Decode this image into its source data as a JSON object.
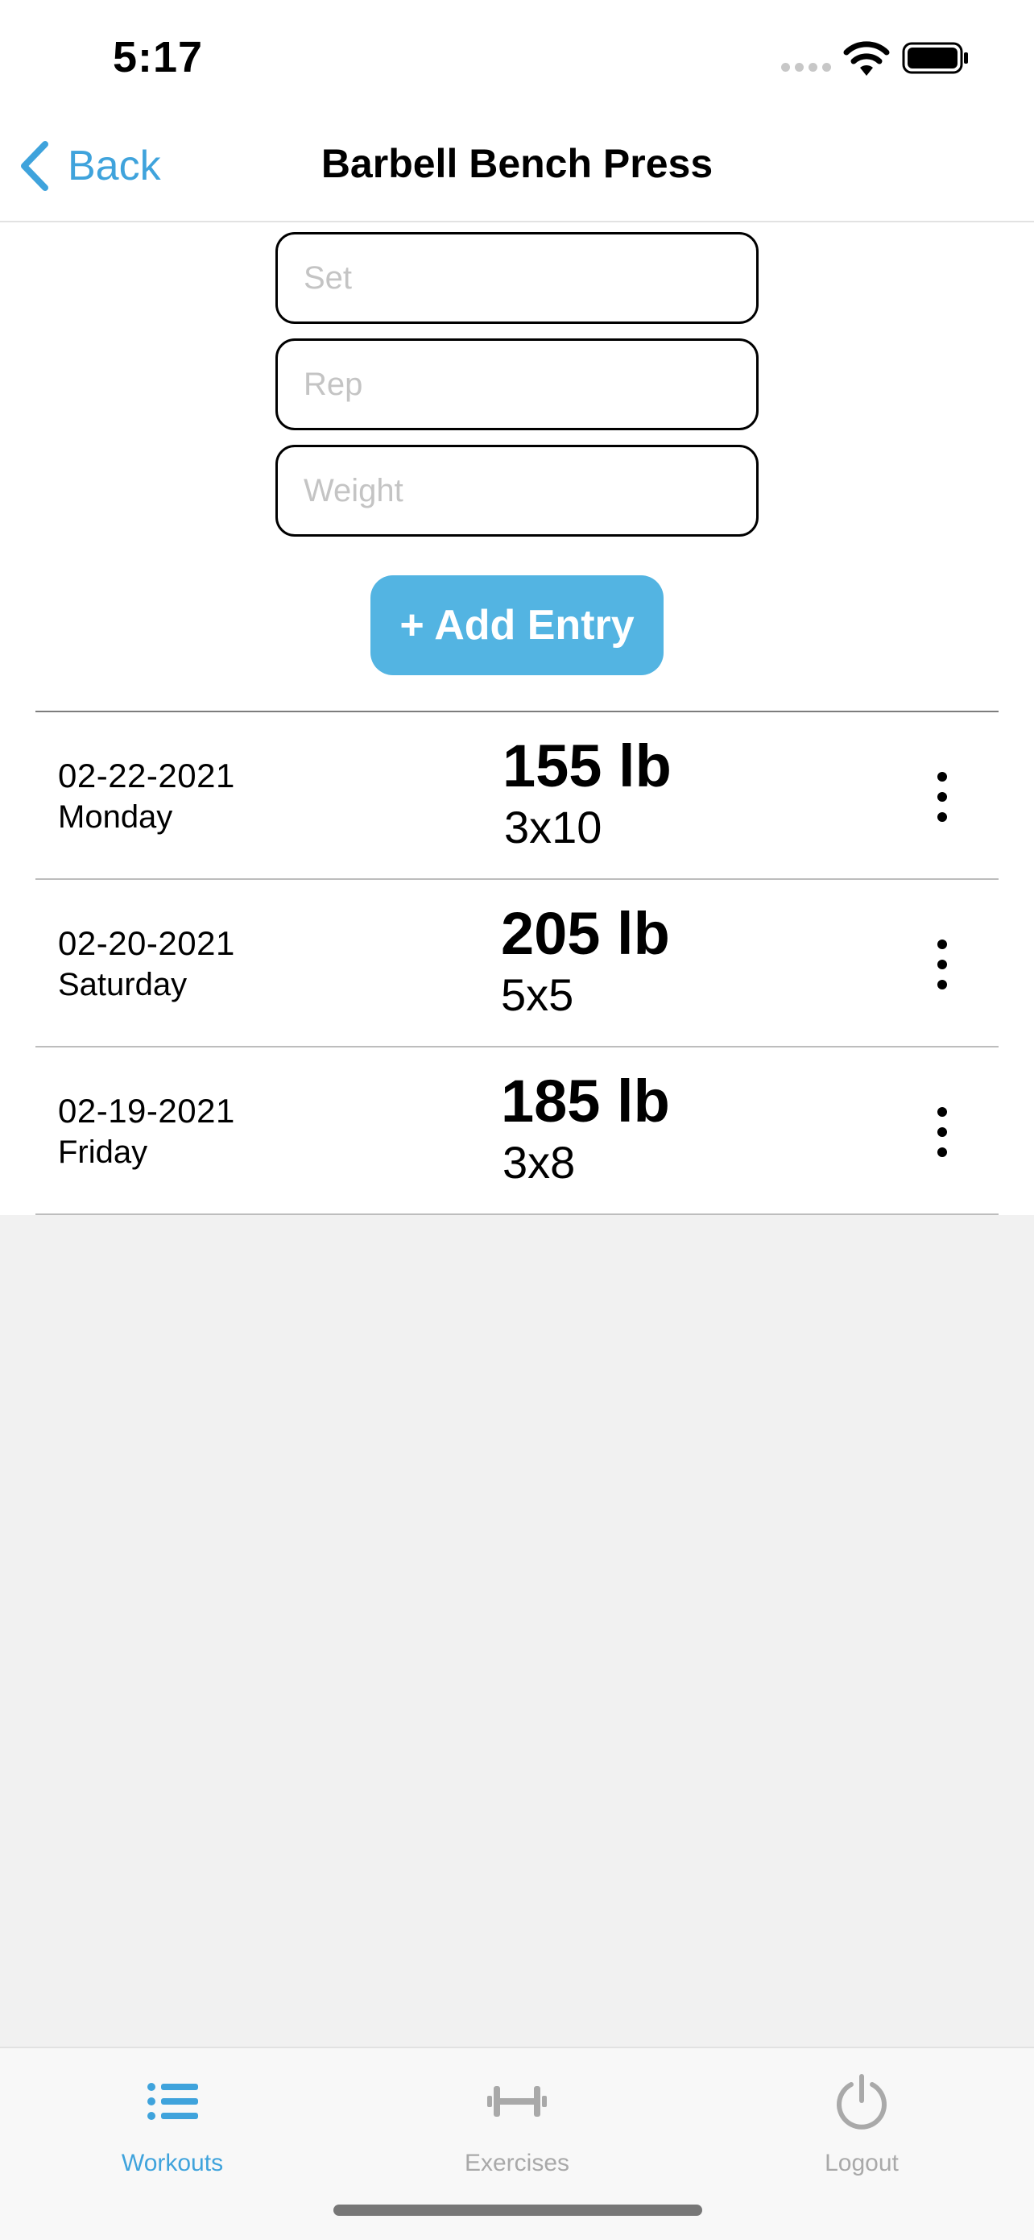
{
  "status": {
    "time": "5:17"
  },
  "nav": {
    "back_label": "Back",
    "title": "Barbell Bench Press"
  },
  "form": {
    "set_placeholder": "Set",
    "rep_placeholder": "Rep",
    "weight_placeholder": "Weight",
    "add_label": "+ Add Entry"
  },
  "entries": [
    {
      "date": "02-22-2021",
      "day": "Monday",
      "weight": "155 lb",
      "sets": "3x10"
    },
    {
      "date": "02-20-2021",
      "day": "Saturday",
      "weight": "205 lb",
      "sets": "5x5"
    },
    {
      "date": "02-19-2021",
      "day": "Friday",
      "weight": "185 lb",
      "sets": "3x8"
    }
  ],
  "tabs": [
    {
      "label": "Workouts",
      "icon": "list-icon",
      "active": true
    },
    {
      "label": "Exercises",
      "icon": "dumbbell-icon",
      "active": false
    },
    {
      "label": "Logout",
      "icon": "power-icon",
      "active": false
    }
  ],
  "colors": {
    "accent": "#3fa3dc",
    "button": "#53b4e2",
    "inactive": "#a9a9a9"
  }
}
